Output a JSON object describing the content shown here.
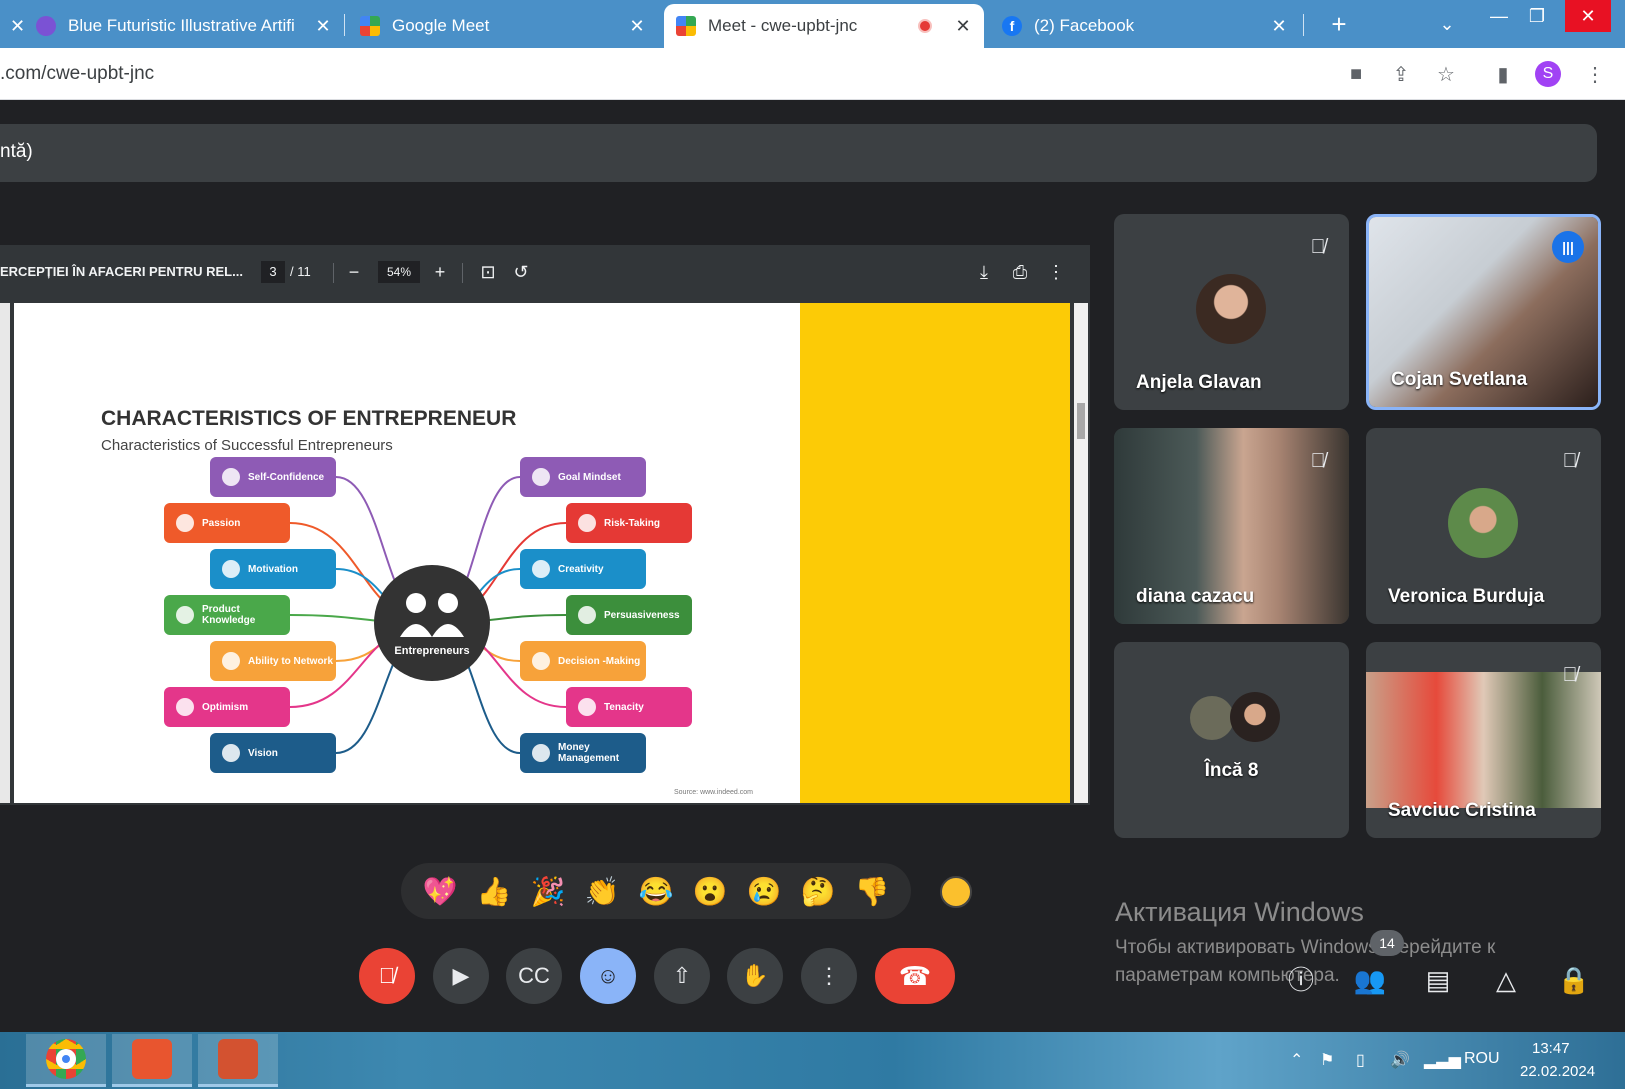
{
  "browser": {
    "tabs": [
      {
        "title": "Blue Futuristic Illustrative Artifi",
        "close": "✕"
      },
      {
        "title": "Google Meet",
        "close": "✕"
      },
      {
        "title": "Meet - cwe-upbt-jnc",
        "close": "✕"
      },
      {
        "title": "(2) Facebook",
        "close": "✕"
      }
    ],
    "new_tab": "+",
    "url": ".com/cwe-upbt-jnc",
    "profile_initial": "S"
  },
  "meet": {
    "presenter_banner": "ntă)",
    "pdf": {
      "title": "ERCEPȚIEI ÎN AFACERI PENTRU REL...",
      "page": "3",
      "page_total": "/ 11",
      "zoom": "54%"
    },
    "slide": {
      "title": "CHARACTERISTICS OF ENTREPRENEUR",
      "subtitle": "Characteristics of Successful Entrepreneurs",
      "center": "Entrepreneurs",
      "source": "Source: www.indeed.com",
      "left_items": [
        "Self-Confidence",
        "Passion",
        "Motivation",
        "Product Knowledge",
        "Ability to Network",
        "Optimism",
        "Vision"
      ],
      "right_items": [
        "Goal Mindset",
        "Risk-Taking",
        "Creativity",
        "Persuasiveness",
        "Decision -Making",
        "Tenacity",
        "Money Management"
      ],
      "colors": {
        "purple": "#8e5bb5",
        "orange": "#ef5a2a",
        "blue": "#1b8fc9",
        "green": "#4aa84a",
        "light_orange": "#f7a23a",
        "pink": "#e4368a",
        "navy": "#1d5c8a",
        "red": "#e53935",
        "dark_green": "#3c8f3c",
        "yellow": "#fccb06"
      }
    },
    "participants": [
      {
        "name": "Anjela Glavan"
      },
      {
        "name": "Cojan Svetlana"
      },
      {
        "name": "diana cazacu"
      },
      {
        "name": "Veronica Burduja"
      },
      {
        "name": "Încă 8"
      },
      {
        "name": "Savciuc Cristina"
      }
    ],
    "reactions": [
      "💖",
      "👍",
      "🎉",
      "👏",
      "😂",
      "😮",
      "😢",
      "🤔",
      "👎"
    ],
    "people_count": "14",
    "watermark": {
      "title": "Активация Windows",
      "text": "Чтобы активировать Windows, перейдите к параметрам компьютера."
    }
  },
  "taskbar": {
    "language": "ROU",
    "time": "13:47",
    "date": "22.02.2024"
  }
}
